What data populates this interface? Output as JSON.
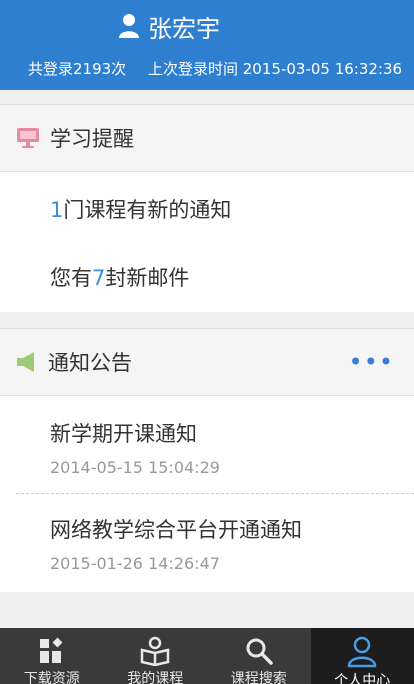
{
  "header": {
    "user_name": "张宏宇",
    "login_count": "共登录2193次",
    "last_login": "上次登录时间 2015-03-05 16:32:36"
  },
  "reminder": {
    "title": "学习提醒",
    "course_prefix": "1",
    "course_suffix": "门课程有新的通知",
    "mail_prefix": "您有",
    "mail_count": "7",
    "mail_suffix": "封新邮件"
  },
  "notice": {
    "title": "通知公告",
    "more": "•••",
    "items": [
      {
        "title": "新学期开课通知",
        "date": "2014-05-15 15:04:29"
      },
      {
        "title": "网络教学综合平台开通通知",
        "date": "2015-01-26 14:26:47"
      }
    ]
  },
  "tabs": [
    {
      "label": "下载资源",
      "icon": "download-resources-icon"
    },
    {
      "label": "我的课程",
      "icon": "my-courses-icon"
    },
    {
      "label": "课程搜索",
      "icon": "search-icon"
    },
    {
      "label": "个人中心",
      "icon": "person-icon",
      "active": true
    }
  ],
  "colors": {
    "header_bg": "#2f7fd0",
    "accent_number": "#3a8fdc",
    "tabbar_bg": "#3a3a3a",
    "tab_active_bg": "#1d1d1d"
  }
}
